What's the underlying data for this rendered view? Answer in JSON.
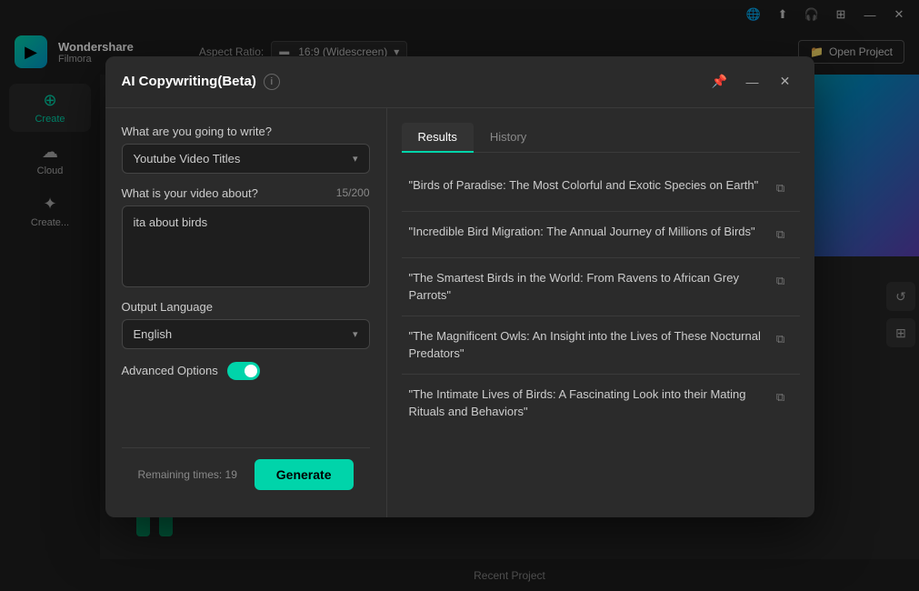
{
  "titlebar": {
    "icons": [
      "globe-icon",
      "upload-icon",
      "headset-icon",
      "grid-icon",
      "minimize-icon",
      "close-icon"
    ]
  },
  "appHeader": {
    "logo": "▶",
    "appName": "Wondershare",
    "appSub": "Filmora",
    "aspectRatioLabel": "Aspect Ratio:",
    "aspectRatioValue": "16:9 (Widescreen)",
    "openProjectLabel": "Open Project"
  },
  "sidebar": {
    "items": [
      {
        "id": "create",
        "label": "Create",
        "icon": "+"
      },
      {
        "id": "cloud",
        "label": "Cloud",
        "icon": "☁"
      },
      {
        "id": "creative",
        "label": "Create...",
        "icon": "✦"
      }
    ]
  },
  "footer": {
    "recentProject": "Recent Project"
  },
  "modal": {
    "title": "AI Copywriting(Beta)",
    "infoIcon": "i",
    "pinIcon": "📌",
    "minimizeIcon": "—",
    "closeIcon": "✕",
    "leftPanel": {
      "writeLabel": "What are you going to write?",
      "writeDropdownValue": "Youtube Video Titles",
      "videoAboutLabel": "What is your video about?",
      "videoAboutCounter": "15/200",
      "videoAboutValue": "ita about birds",
      "outputLanguageLabel": "Output Language",
      "outputLanguageValue": "English",
      "advancedOptionsLabel": "Advanced Options",
      "toggleState": true,
      "remainingLabel": "Remaining times: 19",
      "generateLabel": "Generate"
    },
    "rightPanel": {
      "tabs": [
        {
          "id": "results",
          "label": "Results",
          "active": true
        },
        {
          "id": "history",
          "label": "History",
          "active": false
        }
      ],
      "results": [
        {
          "id": 1,
          "text": "\"Birds of Paradise: The Most Colorful and Exotic Species on Earth\""
        },
        {
          "id": 2,
          "text": "\"Incredible Bird Migration: The Annual Journey of Millions of Birds\""
        },
        {
          "id": 3,
          "text": "\"The Smartest Birds in the World: From Ravens to African Grey Parrots\""
        },
        {
          "id": 4,
          "text": "\"The Magnificent Owls: An Insight into the Lives of These Nocturnal Predators\""
        },
        {
          "id": 5,
          "text": "\"The Intimate Lives of Birds: A Fascinating Look into their Mating Rituals and Behaviors\""
        }
      ]
    }
  }
}
